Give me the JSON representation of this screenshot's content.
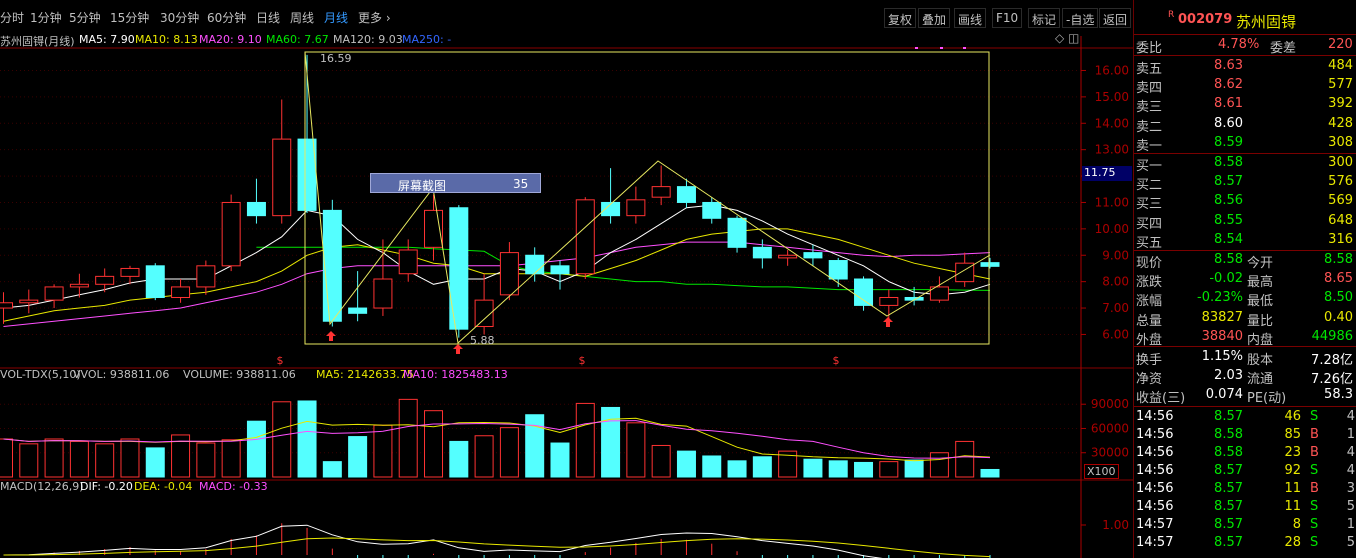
{
  "periods": [
    "分时",
    "1分钟",
    "5分钟",
    "15分钟",
    "30分钟",
    "60分钟",
    "日线",
    "周线",
    "月线",
    "更多 ›"
  ],
  "active_period": "月线",
  "toolbar": [
    "复权",
    "叠加",
    "画线",
    "F10",
    "标记",
    "-自选",
    "返回"
  ],
  "main_legend": {
    "name": "苏州固锝(月线)",
    "ma5": "MA5: 7.90",
    "ma10": "MA10: 8.13",
    "ma20": "MA20: 9.10",
    "ma60": "MA60: 7.67",
    "ma120": "MA120: 9.03",
    "ma250": "MA250: -"
  },
  "vol_legend": {
    "name": "VOL-TDX(5,10)",
    "vvol": "VVOL: 938811.06",
    "volume": "VOLUME: 938811.06",
    "ma5": "MA5: 2142633.75",
    "ma10": "MA10: 1825483.13"
  },
  "macd_legend": {
    "name": "MACD(12,26,9)",
    "dif": "DIF: -0.20",
    "dea": "DEA: -0.04",
    "macd": "MACD: -0.33"
  },
  "annotations": {
    "high": "16.59",
    "low": "5.88",
    "current_price_tag": "11.75",
    "x100": "X100"
  },
  "screenshot_popup": {
    "label": "屏幕截图",
    "value": "35"
  },
  "colors": {
    "up": "#ff3232",
    "down": "#54ffff",
    "ma5": "#ffffff",
    "ma10": "#e8e800",
    "ma20": "#ff50ff",
    "ma60": "#00e600",
    "ma120": "#c0c0c0",
    "ma250": "#3366ff",
    "axis": "#aa0000"
  },
  "chart_data": [
    {
      "type": "candlestick",
      "title": "苏州固锝(月线)",
      "yaxis_ticks": [
        "16.00",
        "15.00",
        "14.00",
        "13.00",
        "12.00",
        "11.00",
        "10.00",
        "9.00",
        "8.00",
        "7.00",
        "6.00"
      ],
      "ylim": [
        5.6,
        16.7
      ],
      "candles": [
        {
          "o": 7.0,
          "h": 7.6,
          "l": 6.4,
          "c": 7.2
        },
        {
          "o": 7.2,
          "h": 7.7,
          "l": 6.8,
          "c": 7.3
        },
        {
          "o": 7.3,
          "h": 7.9,
          "l": 7.0,
          "c": 7.8
        },
        {
          "o": 7.8,
          "h": 8.3,
          "l": 7.4,
          "c": 7.9
        },
        {
          "o": 7.9,
          "h": 8.5,
          "l": 7.6,
          "c": 8.2
        },
        {
          "o": 8.2,
          "h": 8.6,
          "l": 7.9,
          "c": 8.5
        },
        {
          "o": 8.6,
          "h": 8.7,
          "l": 7.3,
          "c": 7.4
        },
        {
          "o": 7.4,
          "h": 8.1,
          "l": 7.2,
          "c": 7.8
        },
        {
          "o": 7.8,
          "h": 8.8,
          "l": 7.5,
          "c": 8.6
        },
        {
          "o": 8.6,
          "h": 11.3,
          "l": 8.4,
          "c": 11.0
        },
        {
          "o": 11.0,
          "h": 11.9,
          "l": 10.2,
          "c": 10.5
        },
        {
          "o": 10.5,
          "h": 14.9,
          "l": 10.2,
          "c": 13.4
        },
        {
          "o": 13.4,
          "h": 16.59,
          "l": 10.6,
          "c": 10.7
        },
        {
          "o": 10.7,
          "h": 11.1,
          "l": 6.3,
          "c": 6.5
        },
        {
          "o": 7.0,
          "h": 8.4,
          "l": 6.5,
          "c": 6.8
        },
        {
          "o": 7.0,
          "h": 9.6,
          "l": 6.7,
          "c": 8.1
        },
        {
          "o": 8.3,
          "h": 9.6,
          "l": 8.0,
          "c": 9.2
        },
        {
          "o": 9.3,
          "h": 11.3,
          "l": 8.8,
          "c": 10.7
        },
        {
          "o": 10.8,
          "h": 10.9,
          "l": 5.88,
          "c": 6.2
        },
        {
          "o": 6.3,
          "h": 8.3,
          "l": 6.0,
          "c": 7.3
        },
        {
          "o": 7.5,
          "h": 9.5,
          "l": 7.3,
          "c": 9.1
        },
        {
          "o": 9.0,
          "h": 9.3,
          "l": 8.0,
          "c": 8.3
        },
        {
          "o": 8.6,
          "h": 8.8,
          "l": 7.7,
          "c": 8.3
        },
        {
          "o": 8.3,
          "h": 11.2,
          "l": 8.1,
          "c": 11.1
        },
        {
          "o": 11.0,
          "h": 12.3,
          "l": 10.2,
          "c": 10.5
        },
        {
          "o": 10.5,
          "h": 11.6,
          "l": 10.2,
          "c": 11.1
        },
        {
          "o": 11.2,
          "h": 12.4,
          "l": 10.9,
          "c": 11.6
        },
        {
          "o": 11.6,
          "h": 11.9,
          "l": 10.8,
          "c": 11.0
        },
        {
          "o": 11.0,
          "h": 11.2,
          "l": 10.2,
          "c": 10.4
        },
        {
          "o": 10.4,
          "h": 10.5,
          "l": 9.1,
          "c": 9.3
        },
        {
          "o": 9.3,
          "h": 9.6,
          "l": 8.5,
          "c": 8.9
        },
        {
          "o": 8.9,
          "h": 9.2,
          "l": 8.6,
          "c": 9.0
        },
        {
          "o": 9.1,
          "h": 9.4,
          "l": 8.6,
          "c": 8.9
        },
        {
          "o": 8.8,
          "h": 8.9,
          "l": 7.8,
          "c": 8.1
        },
        {
          "o": 8.1,
          "h": 8.2,
          "l": 6.9,
          "c": 7.1
        },
        {
          "o": 7.1,
          "h": 7.7,
          "l": 6.6,
          "c": 7.4
        },
        {
          "o": 7.4,
          "h": 7.8,
          "l": 7.1,
          "c": 7.3
        },
        {
          "o": 7.3,
          "h": 8.2,
          "l": 7.2,
          "c": 7.8
        },
        {
          "o": 8.0,
          "h": 9.1,
          "l": 7.8,
          "c": 8.7
        },
        {
          "o": 8.72,
          "h": 8.9,
          "l": 8.5,
          "c": 8.58
        }
      ]
    },
    {
      "type": "bar",
      "title": "VOL-TDX(5,10)",
      "yaxis_ticks": [
        "90000",
        "60000",
        "30000"
      ],
      "ylim": [
        0,
        115000
      ],
      "values": [
        47000,
        41000,
        47000,
        44000,
        41000,
        47000,
        36000,
        52000,
        42000,
        46000,
        69000,
        93000,
        94000,
        19000,
        50000,
        64000,
        96000,
        82000,
        44000,
        51000,
        61000,
        77000,
        42000,
        91000,
        86000,
        67000,
        39000,
        32000,
        26000,
        20000,
        25000,
        32000,
        22000,
        20000,
        18000,
        19000,
        21000,
        30000,
        44000,
        9300
      ]
    }
  ],
  "moving_averages": {
    "ma5": [
      7.0,
      7.1,
      7.3,
      7.5,
      7.7,
      7.95,
      8.1,
      8.1,
      8.1,
      8.6,
      9.1,
      9.7,
      10.7,
      10.5,
      9.6,
      9.1,
      8.4,
      7.9,
      8.1,
      8.1,
      8.5,
      8.4,
      8.0,
      8.4,
      9.1,
      9.6,
      10.2,
      10.8,
      10.9,
      10.7,
      10.3,
      9.8,
      9.4,
      9.0,
      8.6,
      8.0,
      7.6,
      7.5,
      7.6,
      7.9
    ],
    "ma10": [
      6.5,
      6.7,
      6.9,
      7.0,
      7.1,
      7.3,
      7.4,
      7.5,
      7.6,
      7.8,
      8.0,
      8.4,
      9.0,
      9.3,
      9.4,
      9.2,
      9.0,
      8.7,
      8.6,
      8.3,
      8.3,
      8.3,
      8.3,
      8.2,
      8.5,
      8.8,
      9.2,
      9.6,
      9.8,
      9.9,
      10.0,
      10.0,
      9.8,
      9.6,
      9.3,
      9.0,
      8.7,
      8.5,
      8.3,
      8.1
    ],
    "ma20": [
      6.3,
      6.4,
      6.5,
      6.6,
      6.7,
      6.8,
      6.9,
      7.0,
      7.2,
      7.4,
      7.6,
      7.9,
      8.3,
      8.5,
      8.6,
      8.6,
      8.6,
      8.6,
      8.6,
      8.6,
      8.6,
      8.7,
      8.8,
      8.9,
      9.1,
      9.3,
      9.4,
      9.5,
      9.5,
      9.5,
      9.4,
      9.3,
      9.2,
      9.1,
      9.0,
      8.95,
      9.0,
      9.0,
      9.05,
      9.1
    ],
    "ma60": [
      null,
      null,
      null,
      null,
      null,
      null,
      null,
      null,
      null,
      null,
      9.3,
      9.3,
      9.3,
      9.3,
      9.3,
      9.3,
      9.3,
      9.25,
      9.2,
      9.15,
      8.6,
      8.4,
      8.3,
      8.2,
      8.1,
      8.0,
      8.0,
      7.9,
      7.9,
      7.85,
      7.8,
      7.8,
      7.75,
      7.7,
      7.7,
      7.7,
      7.7,
      7.7,
      7.68,
      7.67
    ]
  },
  "quote": {
    "badge": "R",
    "code": "002079",
    "name": "苏州固锝",
    "webi": {
      "label": "委比",
      "value": "4.78%",
      "diff_label": "委差",
      "diff": "220"
    },
    "asks": [
      {
        "label": "卖五",
        "price": "8.63",
        "vol": "484"
      },
      {
        "label": "卖四",
        "price": "8.62",
        "vol": "577"
      },
      {
        "label": "卖三",
        "price": "8.61",
        "vol": "392"
      },
      {
        "label": "卖二",
        "price": "8.60",
        "vol": "428"
      },
      {
        "label": "卖一",
        "price": "8.59",
        "vol": "308"
      }
    ],
    "bids": [
      {
        "label": "买一",
        "price": "8.58",
        "vol": "300"
      },
      {
        "label": "买二",
        "price": "8.57",
        "vol": "576"
      },
      {
        "label": "买三",
        "price": "8.56",
        "vol": "569"
      },
      {
        "label": "买四",
        "price": "8.55",
        "vol": "648"
      },
      {
        "label": "买五",
        "price": "8.54",
        "vol": "316"
      }
    ],
    "stats": [
      {
        "l1": "现价",
        "v1": "8.58",
        "l2": "今开",
        "v2": "8.58"
      },
      {
        "l1": "涨跌",
        "v1": "-0.02",
        "l2": "最高",
        "v2": "8.65"
      },
      {
        "l1": "涨幅",
        "v1": "-0.23%",
        "l2": "最低",
        "v2": "8.50"
      },
      {
        "l1": "总量",
        "v1": "83827",
        "l2": "量比",
        "v2": "0.40"
      },
      {
        "l1": "外盘",
        "v1": "38840",
        "l2": "内盘",
        "v2": "44986"
      }
    ],
    "info": [
      {
        "l1": "换手",
        "v1": "1.15%",
        "l2": "股本",
        "v2": "7.28亿"
      },
      {
        "l1": "净资",
        "v1": "2.03",
        "l2": "流通",
        "v2": "7.26亿"
      },
      {
        "l1": "收益(三)",
        "v1": "0.074",
        "l2": "PE(动)",
        "v2": "58.3"
      }
    ],
    "ticks": [
      {
        "t": "14:56",
        "p": "8.57",
        "v": "46",
        "s": "S",
        "n": "4"
      },
      {
        "t": "14:56",
        "p": "8.58",
        "v": "85",
        "s": "B",
        "n": "1"
      },
      {
        "t": "14:56",
        "p": "8.58",
        "v": "23",
        "s": "B",
        "n": "4"
      },
      {
        "t": "14:56",
        "p": "8.57",
        "v": "92",
        "s": "S",
        "n": "4"
      },
      {
        "t": "14:56",
        "p": "8.57",
        "v": "11",
        "s": "B",
        "n": "3"
      },
      {
        "t": "14:56",
        "p": "8.57",
        "v": "11",
        "s": "S",
        "n": "5"
      },
      {
        "t": "14:57",
        "p": "8.57",
        "v": "8",
        "s": "S",
        "n": "1"
      },
      {
        "t": "14:57",
        "p": "8.57",
        "v": "28",
        "s": "S",
        "n": "5"
      }
    ]
  }
}
